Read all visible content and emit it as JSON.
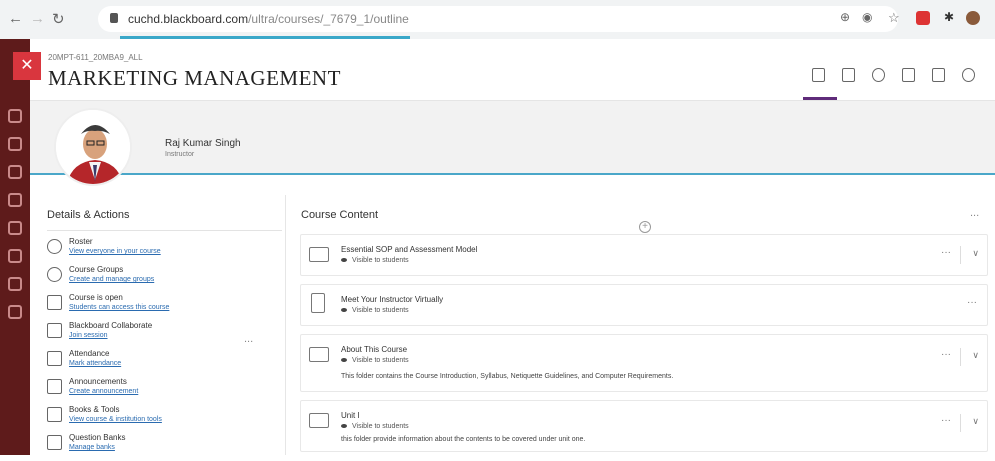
{
  "browser": {
    "url_domain": "cuchd.blackboard.com",
    "url_path": "/ultra/courses/_7679_1/outline"
  },
  "header": {
    "course_code": "20MPT-611_20MBA9_ALL",
    "course_title": "MARKETING MANAGEMENT"
  },
  "instructor": {
    "name": "Raj Kumar Singh",
    "role": "Instructor"
  },
  "details": {
    "title": "Details & Actions",
    "more_label": "...",
    "items": [
      {
        "title": "Roster",
        "link": "View everyone in your course",
        "icon": "roster-icon"
      },
      {
        "title": "Course Groups",
        "link": "Create and manage groups",
        "icon": "groups-icon"
      },
      {
        "title": "Course is open",
        "link": "Students can access this course",
        "icon": "lock-open-icon"
      },
      {
        "title": "Blackboard Collaborate",
        "link": "Join session",
        "icon": "collaborate-icon"
      },
      {
        "title": "Attendance",
        "link": "Mark attendance",
        "icon": "attendance-icon"
      },
      {
        "title": "Announcements",
        "link": "Create announcement",
        "icon": "megaphone-icon"
      },
      {
        "title": "Books & Tools",
        "link": "View course & institution tools",
        "icon": "tools-icon"
      },
      {
        "title": "Question Banks",
        "link": "Manage banks",
        "icon": "bank-icon"
      }
    ]
  },
  "content": {
    "title": "Course Content",
    "more_label": "...",
    "items": [
      {
        "title": "Essential SOP and Assessment Model",
        "visibility": "Visible to students",
        "description": "",
        "icon": "folder-icon",
        "expandable": true
      },
      {
        "title": "Meet Your Instructor Virtually",
        "visibility": "Visible to students",
        "description": "",
        "icon": "document-icon",
        "expandable": false
      },
      {
        "title": "About This Course",
        "visibility": "Visible to students",
        "description": "This folder contains the Course Introduction, Syllabus, Netiquette Guidelines, and Computer Requirements.",
        "icon": "folder-icon",
        "expandable": true
      },
      {
        "title": "Unit I",
        "visibility": "Visible to students",
        "description": "this folder provide information about the contents to be covered under unit one.",
        "icon": "folder-icon",
        "expandable": true
      }
    ]
  },
  "colors": {
    "accent_teal": "#4aa7c9",
    "rail": "#5e1b1b",
    "close_red": "#d9363e",
    "link": "#2a6bb0"
  }
}
